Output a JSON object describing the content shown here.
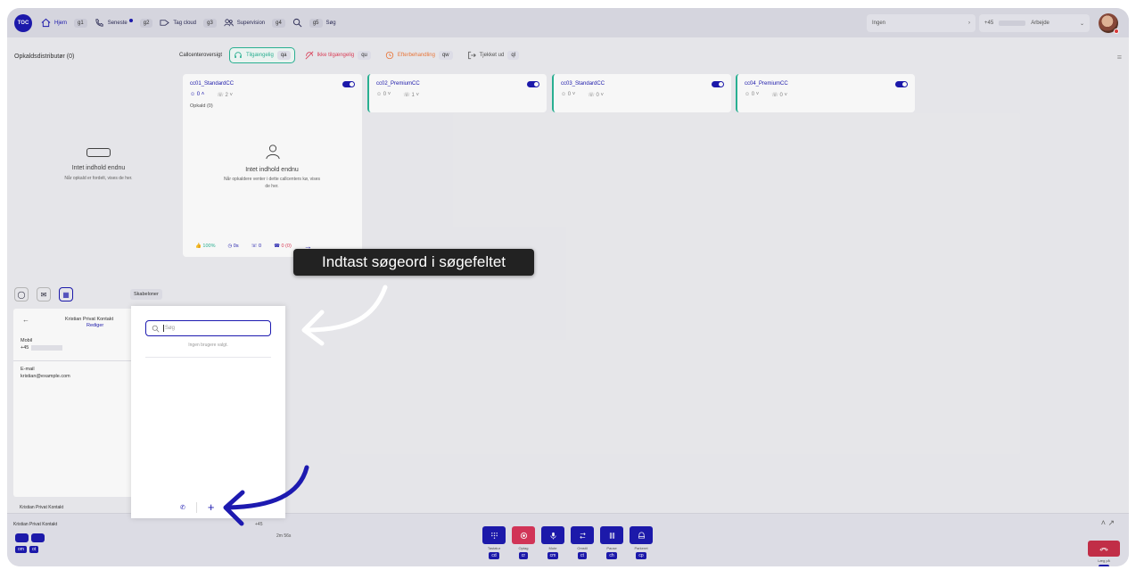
{
  "topbar": {
    "logo": "TOC",
    "nav": [
      {
        "label": "Hjem",
        "key": "g1",
        "icon": "home-icon"
      },
      {
        "label": "Seneste",
        "key": "g2",
        "icon": "phone-recent-icon"
      },
      {
        "label": "Tag cloud",
        "key": "g3",
        "icon": "tag-icon"
      },
      {
        "label": "Supervision",
        "key": "g4",
        "icon": "supervision-icon"
      },
      {
        "label": "Søg",
        "key": "g5",
        "icon": "search-icon"
      }
    ],
    "status_select": "Ingen",
    "phone_prefix": "+45",
    "profile_label": "Arbejde"
  },
  "left_panel": {
    "title": "Opkaldsdistributør (0)",
    "empty_title": "Intet indhold endnu",
    "empty_sub": "Når opkald er fordelt, vises de her."
  },
  "callcenter_bar": {
    "label": "Callcenteroversigt",
    "filters": [
      {
        "label": "Tilgængelig",
        "key": "qa",
        "color": "#2bb596"
      },
      {
        "label": "Ikke tilgængelig",
        "key": "qu",
        "color": "#e0405a"
      },
      {
        "label": "Efterbehandling",
        "key": "qw",
        "color": "#f07a3c"
      },
      {
        "label": "Tjekket ud",
        "key": "ql",
        "color": "#555555"
      }
    ]
  },
  "cards": [
    {
      "name": "cc01_StandardCC",
      "agents": "0",
      "calls": "2",
      "queue_label": "Opkald (0)",
      "empty_title": "Intet indhold endnu",
      "empty_sub": "Når opkaldere venter i dette callcenters kø, vises de her.",
      "footer": [
        "100%",
        "0s",
        "0",
        "0 (0)"
      ]
    },
    {
      "name": "cc02_PremiumCC",
      "agents": "0",
      "calls": "1"
    },
    {
      "name": "cc03_StandardCC",
      "agents": "0",
      "calls": "0"
    },
    {
      "name": "cc04_PremiumCC",
      "agents": "0",
      "calls": "0"
    }
  ],
  "contact_panel": {
    "templates_label": "Skabeloner",
    "name": "Kristian Privat Kontakt",
    "edit_label": "Rediger",
    "mobile_label": "Mobil",
    "mobile_value": "+45",
    "email_label": "E-mail",
    "email_value": "kristian@example.com",
    "footer_name": "Kristian Privat Kontakt"
  },
  "call_bar": {
    "caller": "Kristian Privat Kontakt",
    "number": "+45",
    "duration": "2m 56s",
    "keys_left": [
      "om",
      "ot"
    ],
    "controls": [
      {
        "label": "Tastatur",
        "key": "cd",
        "icon": "keypad-icon"
      },
      {
        "label": "Optag",
        "key": "cr",
        "icon": "record-icon"
      },
      {
        "label": "Mute",
        "key": "cm",
        "icon": "mic-icon"
      },
      {
        "label": "Omstil",
        "key": "ct",
        "icon": "transfer-icon"
      },
      {
        "label": "Pause",
        "key": "ch",
        "icon": "pause-icon"
      },
      {
        "label": "Parkeret",
        "key": "cp",
        "icon": "park-icon"
      }
    ],
    "hangup_label": "Læg på",
    "hangup_key": "ce"
  },
  "popup": {
    "search_placeholder": "Søg",
    "empty_text": "Ingen brugere valgt."
  },
  "tooltip": {
    "text": "Indtast søgeord i søgefeltet"
  }
}
